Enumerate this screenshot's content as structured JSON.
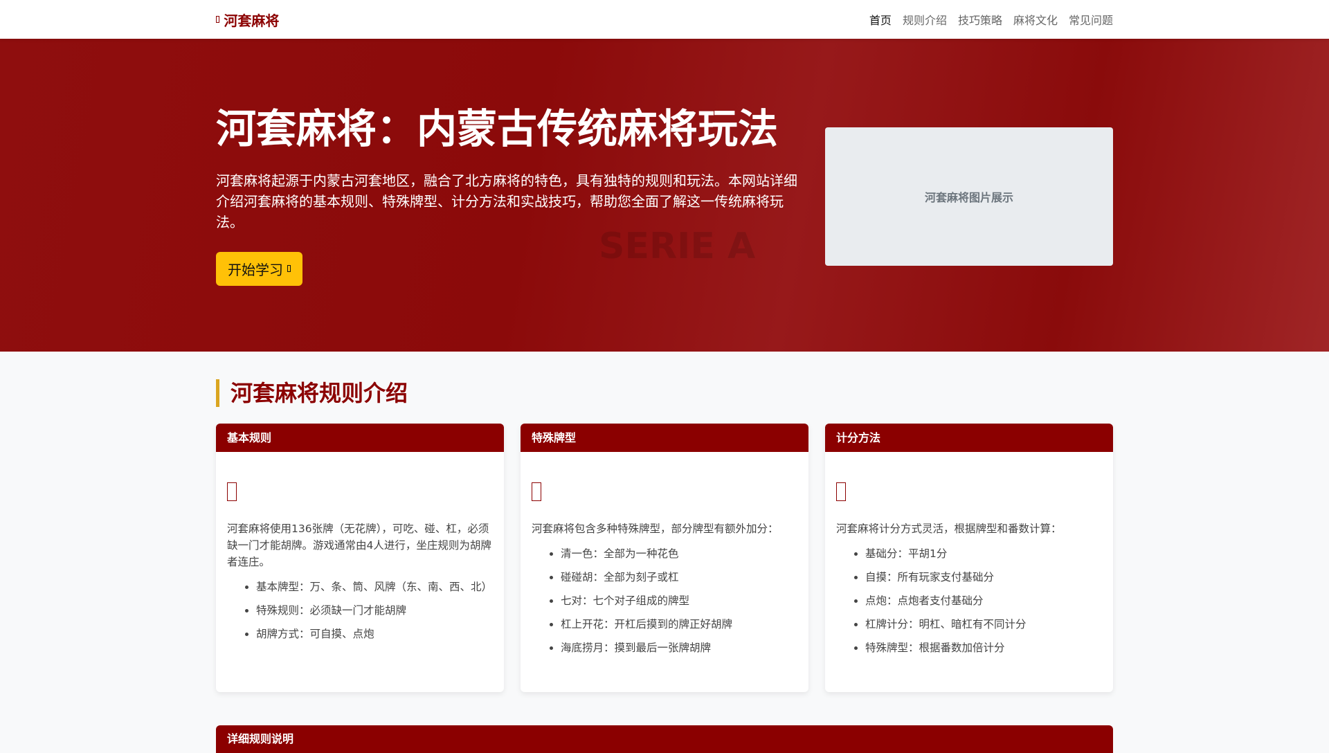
{
  "nav": {
    "brand": "河套麻将",
    "links": [
      "首页",
      "规则介绍",
      "技巧策略",
      "麻将文化",
      "常见问题"
    ]
  },
  "hero": {
    "title": "河套麻将：内蒙古传统麻将玩法",
    "lead": "河套麻将起源于内蒙古河套地区，融合了北方麻将的特色，具有独特的规则和玩法。本网站详细介绍河套麻将的基本规则、特殊牌型、计分方法和实战技巧，帮助您全面了解这一传统麻将玩法。",
    "button": "开始学习",
    "image_placeholder": "河套麻将图片展示",
    "bg_text": "SERIE A"
  },
  "section": {
    "title": "河套麻将规则介绍"
  },
  "cards": [
    {
      "header": "基本规则",
      "intro": "河套麻将使用136张牌（无花牌），可吃、碰、杠，必须缺一门才能胡牌。游戏通常由4人进行，坐庄规则为胡牌者连庄。",
      "items": [
        "基本牌型：万、条、筒、风牌（东、南、西、北）",
        "特殊规则：必须缺一门才能胡牌",
        "胡牌方式：可自摸、点炮"
      ]
    },
    {
      "header": "特殊牌型",
      "intro": "河套麻将包含多种特殊牌型，部分牌型有额外加分：",
      "items": [
        "清一色：全部为一种花色",
        "碰碰胡：全部为刻子或杠",
        "七对：七个对子组成的牌型",
        "杠上开花：开杠后摸到的牌正好胡牌",
        "海底捞月：摸到最后一张牌胡牌"
      ]
    },
    {
      "header": "计分方法",
      "intro": "河套麻将计分方式灵活，根据牌型和番数计算：",
      "items": [
        "基础分：平胡1分",
        "自摸：所有玩家支付基础分",
        "点炮：点炮者支付基础分",
        "杠牌计分：明杠、暗杠有不同计分",
        "特殊牌型：根据番数加倍计分"
      ]
    }
  ],
  "detail": {
    "header": "详细规则说明"
  }
}
